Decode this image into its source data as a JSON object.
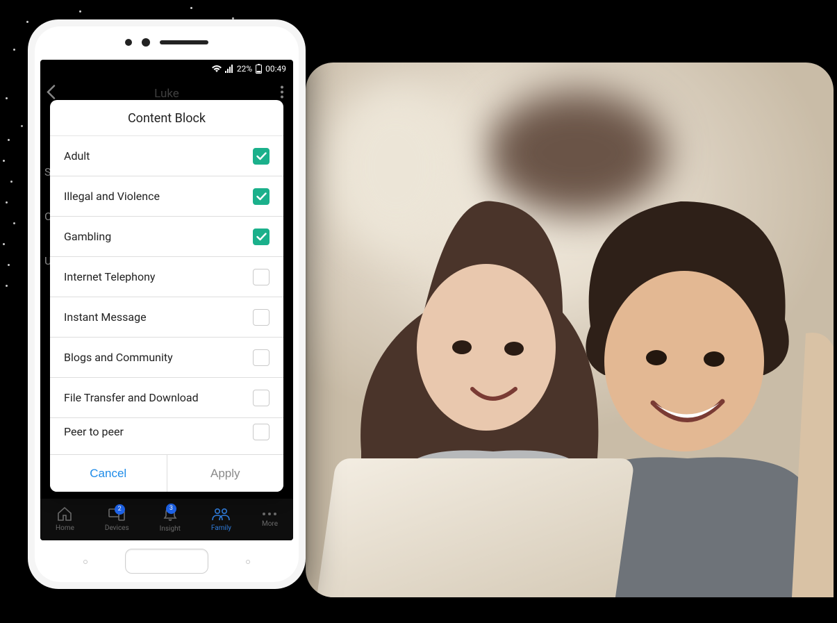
{
  "status_bar": {
    "battery_text": "22%",
    "time": "00:49"
  },
  "app_header": {
    "title": "Luke"
  },
  "background_side_letters": [
    "S",
    "C",
    "U"
  ],
  "modal": {
    "title": "Content Block",
    "items": [
      {
        "label": "Adult",
        "checked": true
      },
      {
        "label": "Illegal and Violence",
        "checked": true
      },
      {
        "label": "Gambling",
        "checked": true
      },
      {
        "label": "Internet Telephony",
        "checked": false
      },
      {
        "label": "Instant Message",
        "checked": false
      },
      {
        "label": "Blogs and Community",
        "checked": false
      },
      {
        "label": "File Transfer and Download",
        "checked": false
      },
      {
        "label": "Peer to peer",
        "checked": false
      }
    ],
    "cancel_label": "Cancel",
    "apply_label": "Apply"
  },
  "tab_bar": {
    "items": [
      {
        "id": "home",
        "label": "Home",
        "icon": "home-icon",
        "badge": null,
        "active": false
      },
      {
        "id": "devices",
        "label": "Devices",
        "icon": "devices-icon",
        "badge": "2",
        "active": false
      },
      {
        "id": "insight",
        "label": "Insight",
        "icon": "bell-icon",
        "badge": "3",
        "active": false
      },
      {
        "id": "family",
        "label": "Family",
        "icon": "people-icon",
        "badge": null,
        "active": true
      },
      {
        "id": "more",
        "label": "More",
        "icon": "more-icon",
        "badge": null,
        "active": false
      }
    ]
  },
  "colors": {
    "checkbox_on": "#1bb08b",
    "primary_blue": "#1e8be8",
    "badge_blue": "#1e63e9"
  }
}
